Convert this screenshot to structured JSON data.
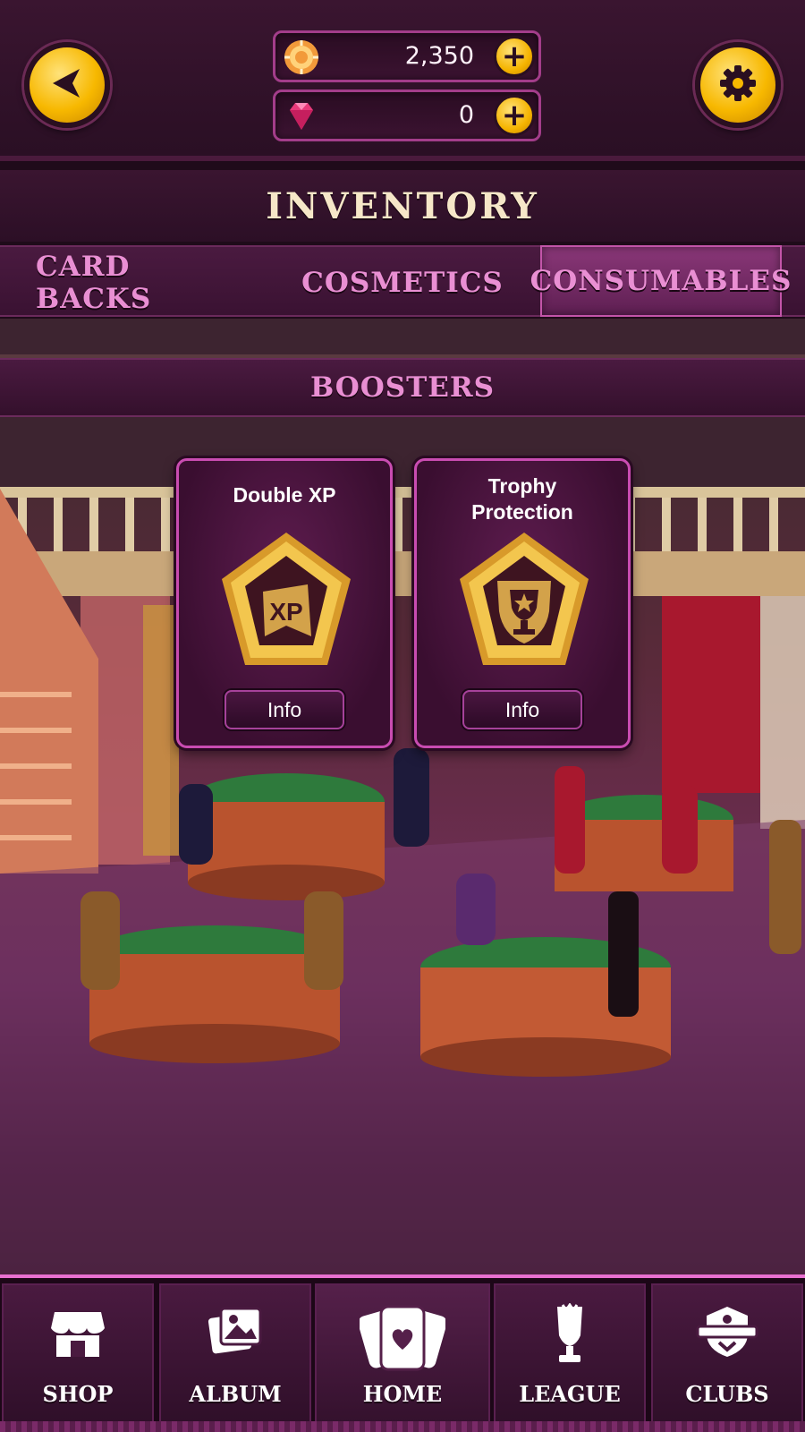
{
  "header": {
    "coins": "2,350",
    "gems": "0",
    "coin_icon": "coin-icon",
    "gem_icon": "gem-icon",
    "add_icon": "+",
    "back_icon": "back-arrow-icon",
    "settings_icon": "gear-icon"
  },
  "title": "INVENTORY",
  "tabs": [
    {
      "label": "CARD BACKS",
      "active": false
    },
    {
      "label": "COSMETICS",
      "active": false
    },
    {
      "label": "CONSUMABLES",
      "active": true
    }
  ],
  "section": "BOOSTERS",
  "boosters": [
    {
      "title": "Double XP",
      "badge": "XP",
      "icon": "xp-badge-icon",
      "button": "Info"
    },
    {
      "title": "Trophy Protection",
      "icon": "trophy-shield-badge-icon",
      "button": "Info"
    }
  ],
  "nav": [
    {
      "label": "SHOP",
      "icon": "shop-icon"
    },
    {
      "label": "ALBUM",
      "icon": "album-icon"
    },
    {
      "label": "HOME",
      "icon": "home-cards-icon"
    },
    {
      "label": "LEAGUE",
      "icon": "trophy-icon"
    },
    {
      "label": "CLUBS",
      "icon": "clubs-shield-icon"
    }
  ],
  "colors": {
    "accent": "#e870d0",
    "gold": "#f7b800",
    "panel": "#3a1530"
  }
}
